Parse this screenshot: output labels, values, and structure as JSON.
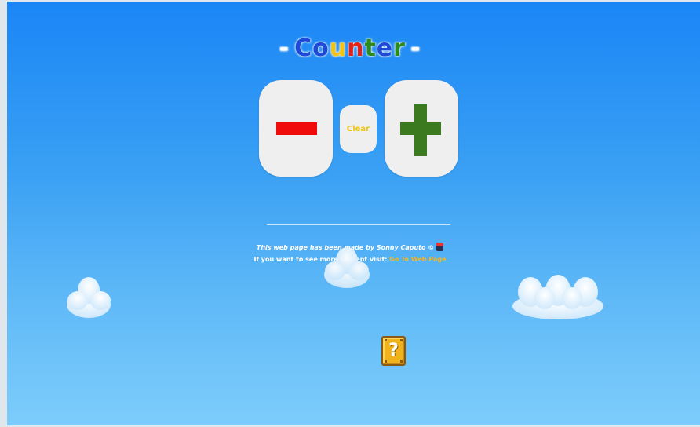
{
  "title": {
    "dash_left": "-",
    "letters": [
      "C",
      "o",
      "u",
      "n",
      "t",
      "e",
      "r"
    ],
    "dash_right": "-"
  },
  "buttons": {
    "decrement_icon": "minus-icon",
    "increment_icon": "plus-icon",
    "clear_label": "Clear"
  },
  "footer": {
    "credit_text": "This web page has been made by Sonny Caputo",
    "copyright_symbol": "©",
    "visit_text": "If you want to see more content visit:",
    "link_label": "Go To Web Page"
  },
  "decorations": {
    "question_block_symbol": "?"
  },
  "colors": {
    "minus": "#f10c0c",
    "plus": "#3b7a1f",
    "clear": "#f2c40f",
    "link": "#f6b51a"
  }
}
